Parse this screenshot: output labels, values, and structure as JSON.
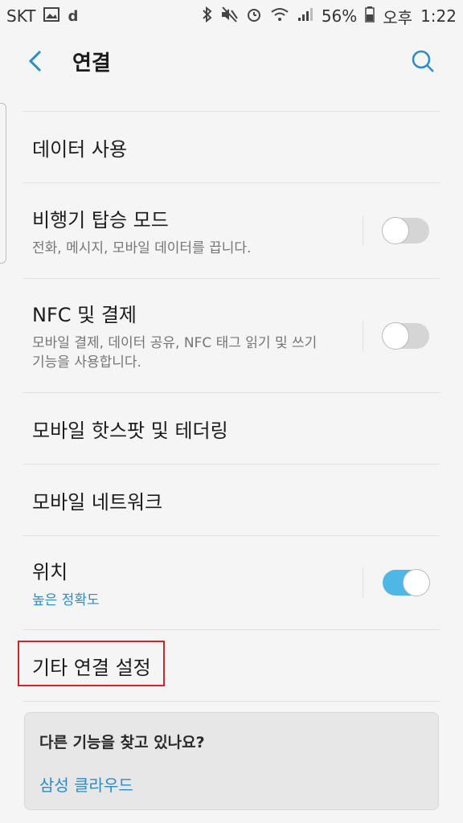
{
  "status_bar": {
    "carrier": "SKT",
    "battery": "56%",
    "time_period": "오후",
    "time": "1:22",
    "left_icons": [
      "gallery-icon",
      "d-app-icon"
    ],
    "right_icons": [
      "bluetooth-icon",
      "mute-icon",
      "alarm-icon",
      "wifi-icon",
      "signal-icon",
      "battery-icon"
    ]
  },
  "app_bar": {
    "title": "연결",
    "back_icon": "chevron-left-icon",
    "search_icon": "search-icon"
  },
  "items": [
    {
      "title": "데이터 사용"
    },
    {
      "title": "비행기 탑승 모드",
      "subtitle": "전화, 메시지, 모바일 데이터를 끕니다.",
      "toggle": false
    },
    {
      "title": "NFC 및 결제",
      "subtitle": "모바일 결제, 데이터 공유, NFC 태그 읽기 및 쓰기 기능을 사용합니다.",
      "toggle": false
    },
    {
      "title": "모바일 핫스팟 및 테더링"
    },
    {
      "title": "모바일 네트워크"
    },
    {
      "title": "위치",
      "subtitle": "높은 정확도",
      "toggle": true
    },
    {
      "title": "기타 연결 설정"
    }
  ],
  "suggestion_card": {
    "title": "다른 기능을 찾고 있나요?",
    "link": "삼성 클라우드"
  },
  "colors": {
    "accent": "#2a8dc7",
    "toggle_on": "#4fb7e6",
    "toggle_off": "#d5d5d5",
    "highlight": "#d4222a",
    "background": "#f5f5f5"
  }
}
